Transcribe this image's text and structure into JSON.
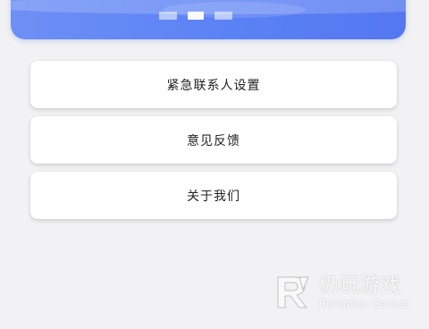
{
  "banner": {
    "dots": [
      false,
      true,
      false
    ],
    "accent": "#5b82f5"
  },
  "menu": {
    "items": [
      {
        "label": "紧急联系人设置"
      },
      {
        "label": "意见反馈"
      },
      {
        "label": "关于我们"
      }
    ]
  },
  "watermark": {
    "title": "仍玩游戏",
    "subtitle": "Rengwan Games",
    "icon": "rengwan-logo-icon"
  }
}
